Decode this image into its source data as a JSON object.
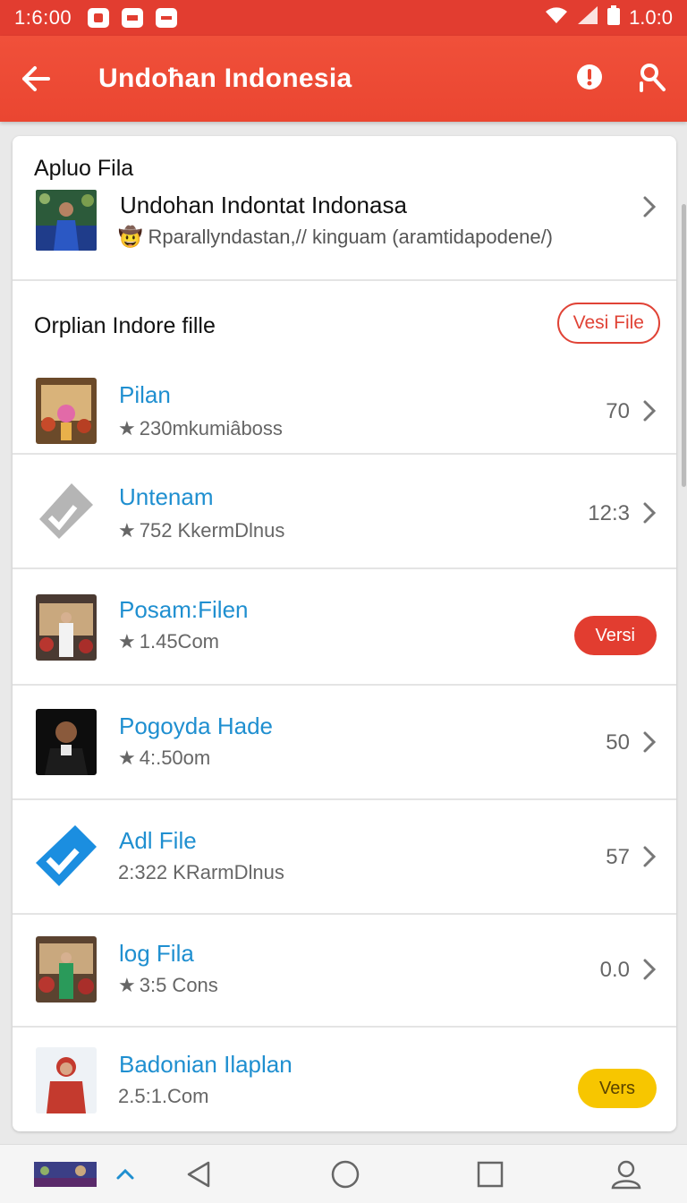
{
  "status_bar": {
    "time": "1:6:00",
    "battery_text": "1.0:0"
  },
  "app_bar": {
    "title": "Undoћan Indonesia"
  },
  "upload_section": {
    "label": "Apluo Fila",
    "item": {
      "name": "Undohan Indontat Indonaѕa",
      "subtitle": "Rparallyndastan,// kinguam (aramtidapodene/)"
    }
  },
  "options_section": {
    "label": "Orplian Indore fille",
    "action_label": "Vesi File"
  },
  "items": [
    {
      "title": "Pilan",
      "meta": "230mkumiâboss",
      "value": "70"
    },
    {
      "title": "Untenam",
      "meta": "752 KkermDlnus",
      "value": "12:3"
    },
    {
      "title": "Posam:Filen",
      "meta": "1.45Com",
      "pill": "Versi"
    },
    {
      "title": "Pogoyda Hade",
      "meta": "4:.50om",
      "value": "50"
    },
    {
      "title": "Adl File",
      "meta": "2:322 KRarmDlnus",
      "value": "57"
    },
    {
      "title": "log Fila",
      "meta": "3:5 Cons",
      "value": "0.0"
    },
    {
      "title": "Badonian Ilaplan",
      "meta": "2.5:1.Com",
      "pill": "Vers"
    }
  ],
  "colors": {
    "brand_red": "#e23d30",
    "link_blue": "#1f8fd0",
    "badge_yellow": "#f7c600"
  }
}
